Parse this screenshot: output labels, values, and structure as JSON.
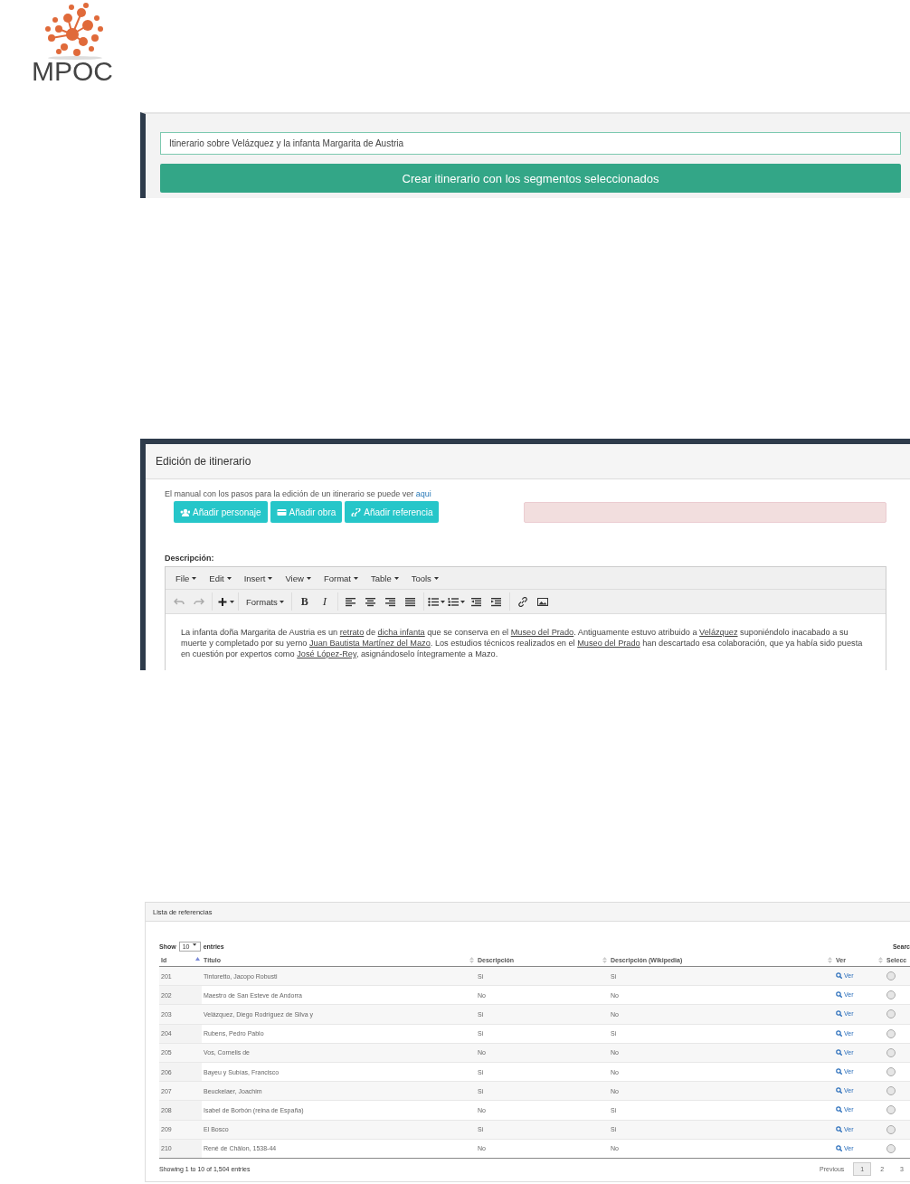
{
  "logo": {
    "text": "MPOC"
  },
  "itinerary_form": {
    "title_field": "Itinerario sobre Velázquez y la infanta Margarita de Austria",
    "create_button": "Crear itinerario con los segmentos seleccionados"
  },
  "edit_panel": {
    "heading": "Edición de itinerario",
    "manual_text": "El manual con los pasos para la edición de un itinerario se puede ver ",
    "manual_link": "aqui",
    "buttons": [
      {
        "kind": "people",
        "label": "Añadir personaje"
      },
      {
        "kind": "card",
        "label": "Añadir obra"
      },
      {
        "kind": "link",
        "label": "Añadir referencia"
      }
    ],
    "description_label": "Descripción:",
    "menu": [
      "File",
      "Edit",
      "Insert",
      "View",
      "Format",
      "Table",
      "Tools"
    ],
    "formats_label": "Formats",
    "bold_label": "B",
    "italic_label": "I",
    "content": [
      {
        "text": "La infanta doña Margarita de Austria es un ",
        "link": false
      },
      {
        "text": "retrato",
        "link": true
      },
      {
        "text": " de ",
        "link": false
      },
      {
        "text": "dicha infanta",
        "link": true
      },
      {
        "text": " que se conserva en el ",
        "link": false
      },
      {
        "text": "Museo del Prado",
        "link": true
      },
      {
        "text": ". Antiguamente estuvo atribuido a ",
        "link": false
      },
      {
        "text": "Velázquez",
        "link": true
      },
      {
        "text": " suponiéndolo inacabado a su muerte y completado por su yerno ",
        "link": false
      },
      {
        "text": "Juan Bautista Martínez del Mazo",
        "link": true
      },
      {
        "text": ". Los estudios técnicos realizados en el ",
        "link": false
      },
      {
        "text": "Museo del Prado",
        "link": true
      },
      {
        "text": " han descartado esa colaboración, que ya había sido puesta en cuestión por expertos como ",
        "link": false
      },
      {
        "text": "José López-Rey",
        "link": true
      },
      {
        "text": ", asignándoselo íntegramente a Mazo.",
        "link": false
      }
    ]
  },
  "references": {
    "heading": "Lista de referencias",
    "show_label": "Show",
    "page_size": "10",
    "entries_label": "entries",
    "search_label": "Searc",
    "columns": [
      "Id",
      "Título",
      "Descripción",
      "Descripción (Wikipedia)",
      "Ver",
      "Selecc"
    ],
    "rows": [
      {
        "id": "201",
        "title": "Tintoretto, Jacopo Robusti",
        "desc": "Si",
        "wiki": "Si",
        "view": "Ver",
        "selected": false
      },
      {
        "id": "202",
        "title": "Maestro de San Esteve de Andorra",
        "desc": "No",
        "wiki": "No",
        "view": "Ver",
        "selected": false
      },
      {
        "id": "203",
        "title": "Velázquez, Diego Rodríguez de Silva y",
        "desc": "Si",
        "wiki": "No",
        "view": "Ver",
        "selected": false
      },
      {
        "id": "204",
        "title": "Rubens, Pedro Pablo",
        "desc": "Si",
        "wiki": "Si",
        "view": "Ver",
        "selected": false
      },
      {
        "id": "205",
        "title": "Vos, Cornelis de",
        "desc": "No",
        "wiki": "No",
        "view": "Ver",
        "selected": false
      },
      {
        "id": "206",
        "title": "Bayeu y Subías, Francisco",
        "desc": "Si",
        "wiki": "No",
        "view": "Ver",
        "selected": false
      },
      {
        "id": "207",
        "title": "Beuckelaer, Joachim",
        "desc": "Si",
        "wiki": "No",
        "view": "Ver",
        "selected": false
      },
      {
        "id": "208",
        "title": "Isabel de Borbón (reina de España)",
        "desc": "No",
        "wiki": "Si",
        "view": "Ver",
        "selected": false
      },
      {
        "id": "209",
        "title": "El Bosco",
        "desc": "Si",
        "wiki": "Si",
        "view": "Ver",
        "selected": false
      },
      {
        "id": "210",
        "title": "René de Châlon, 1538-44",
        "desc": "No",
        "wiki": "No",
        "view": "Ver",
        "selected": false
      }
    ],
    "info": "Showing 1 to 10 of 1,504 entries",
    "pagination": [
      {
        "label": "Previous",
        "selected": false
      },
      {
        "label": "1",
        "selected": true
      },
      {
        "label": "2",
        "selected": false
      },
      {
        "label": "3",
        "selected": false
      }
    ]
  }
}
